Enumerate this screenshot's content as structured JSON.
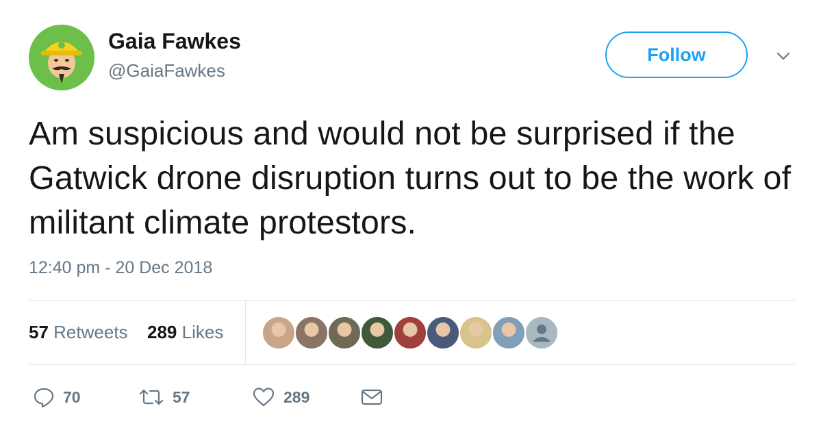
{
  "author": {
    "name": "Gaia Fawkes",
    "handle": "@GaiaFawkes",
    "avatar_icon": "hardhat-cartoon-avatar-icon",
    "avatar_bg": "#6cc04a"
  },
  "follow_label": "Follow",
  "tweet": {
    "text": "Am suspicious and would not be surprised if the Gatwick drone disruption turns out to be the work of militant climate protestors.",
    "timestamp": "12:40 pm - 20 Dec 2018"
  },
  "stats": {
    "retweets_count": "57",
    "retweets_label": "Retweets",
    "likes_count": "289",
    "likes_label": "Likes"
  },
  "likers": [
    {
      "name": "liker-avatar-1",
      "color": "#c9a58a"
    },
    {
      "name": "liker-avatar-2",
      "color": "#8a7466"
    },
    {
      "name": "liker-avatar-3",
      "color": "#6f6a55"
    },
    {
      "name": "liker-avatar-4",
      "color": "#3f5a3a"
    },
    {
      "name": "liker-avatar-5",
      "color": "#a0403a"
    },
    {
      "name": "liker-avatar-6",
      "color": "#4a5a7a"
    },
    {
      "name": "liker-avatar-7",
      "color": "#d8c48a"
    },
    {
      "name": "liker-avatar-8",
      "color": "#7fa0b8"
    },
    {
      "name": "liker-avatar-9",
      "color": "#aab8c2"
    }
  ],
  "actions": {
    "reply_count": "70",
    "retweet_count": "57",
    "like_count": "289"
  },
  "colors": {
    "accent": "#1da1f2",
    "text": "#14171a",
    "secondary": "#657786",
    "divider": "#e1e8ed"
  }
}
